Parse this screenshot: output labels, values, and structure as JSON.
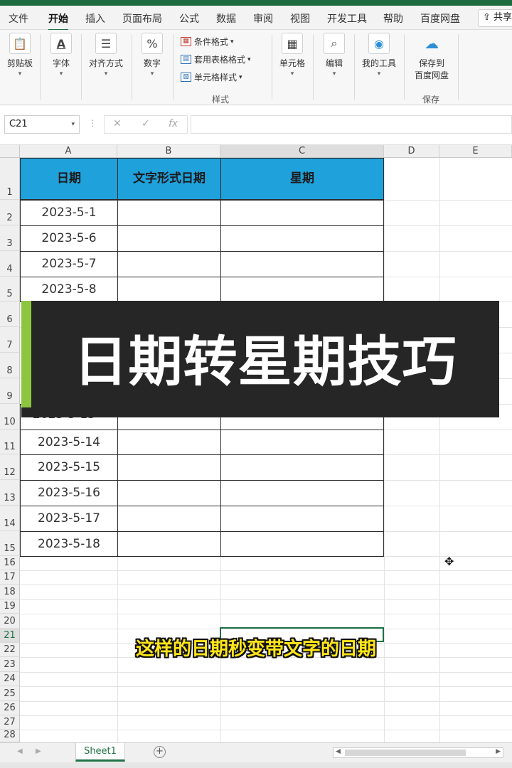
{
  "menu": {
    "tabs": [
      "文件",
      "开始",
      "插入",
      "页面布局",
      "公式",
      "数据",
      "审阅",
      "视图",
      "开发工具",
      "帮助",
      "百度网盘"
    ],
    "active": "开始",
    "share_label": "共享"
  },
  "ribbon": {
    "clipboard": {
      "label": "剪贴板",
      "icon": "clipboard-icon"
    },
    "font": {
      "label": "字体",
      "icon": "font-color-icon"
    },
    "alignment": {
      "label": "对齐方式",
      "icon": "align-icon"
    },
    "number": {
      "label": "数字",
      "icon": "percent-icon",
      "glyph": "%"
    },
    "styles": {
      "items": [
        "条件格式",
        "套用表格格式",
        "单元格样式"
      ],
      "group_label": "样式"
    },
    "cells": {
      "label": "单元格",
      "icon": "cells-icon"
    },
    "editing": {
      "label": "编辑",
      "icon": "search-icon"
    },
    "mytools": {
      "label": "我的工具",
      "icon": "tool-icon"
    },
    "save": {
      "label_line1": "保存到",
      "label_line2": "百度网盘",
      "group_label": "保存",
      "icon": "baidu-cloud-icon"
    }
  },
  "formula_bar": {
    "name_box": "C21",
    "cancel_glyph": "✕",
    "enter_glyph": "✓",
    "fx_label": "fx",
    "value": ""
  },
  "sheet": {
    "columns": [
      "A",
      "B",
      "C",
      "D",
      "E"
    ],
    "rows": [
      "1",
      "2",
      "3",
      "4",
      "5",
      "6",
      "7",
      "8",
      "9",
      "10",
      "11",
      "12",
      "13",
      "14",
      "15",
      "16",
      "17",
      "18",
      "19",
      "20",
      "21",
      "22",
      "23",
      "24",
      "25",
      "26",
      "27",
      "28"
    ],
    "headers": [
      "日期",
      "文字形式日期",
      "星期"
    ],
    "dates_top": [
      "2023-5-1",
      "2023-5-6",
      "2023-5-7",
      "2023-5-8"
    ],
    "partial_row10": "2023-5-13",
    "dates_bottom": [
      "2023-5-14",
      "2023-5-15",
      "2023-5-16",
      "2023-5-17",
      "2023-5-18"
    ],
    "header_fill": "#1fa1dc",
    "selected_cell": "C21"
  },
  "overlay": {
    "title": "日期转星期技巧",
    "accent_color": "#8cc63f"
  },
  "subtitle": "这样的日期秒变带文字的日期",
  "sheet_tabs": {
    "tabs": [
      "Sheet1"
    ],
    "add_glyph": "+"
  }
}
